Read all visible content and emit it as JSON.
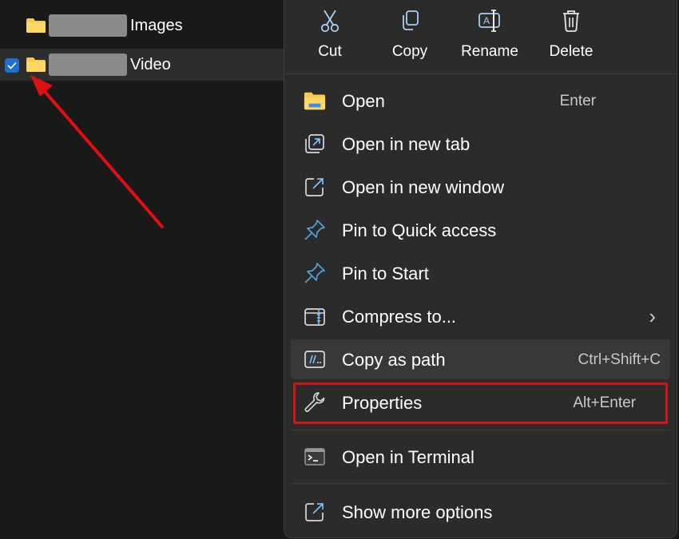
{
  "files": [
    {
      "name": "Images",
      "selected": false
    },
    {
      "name": "Video",
      "selected": true
    }
  ],
  "toolbar": {
    "cut": {
      "label": "Cut",
      "icon": "scissors-icon"
    },
    "copy": {
      "label": "Copy",
      "icon": "copy-icon"
    },
    "rename": {
      "label": "Rename",
      "icon": "rename-icon"
    },
    "delete": {
      "label": "Delete",
      "icon": "trash-icon"
    }
  },
  "menu": {
    "open": {
      "label": "Open",
      "shortcut": "Enter"
    },
    "open_new_tab": {
      "label": "Open in new tab"
    },
    "open_new_window": {
      "label": "Open in new window"
    },
    "pin_quick_access": {
      "label": "Pin to Quick access"
    },
    "pin_start": {
      "label": "Pin to Start"
    },
    "compress": {
      "label": "Compress to...",
      "submenu": "›"
    },
    "copy_path": {
      "label": "Copy as path",
      "shortcut": "Ctrl+Shift+C"
    },
    "properties": {
      "label": "Properties",
      "shortcut": "Alt+Enter"
    },
    "terminal": {
      "label": "Open in Terminal"
    },
    "more_options": {
      "label": "Show more options"
    }
  },
  "colors": {
    "background": "#191919",
    "menu_bg": "#2b2b2b",
    "highlight_border": "#d21414",
    "arrow": "#e01010",
    "checkbox": "#1e6fd0",
    "folder": "#f8c94b",
    "pin": "#4aa3df"
  }
}
